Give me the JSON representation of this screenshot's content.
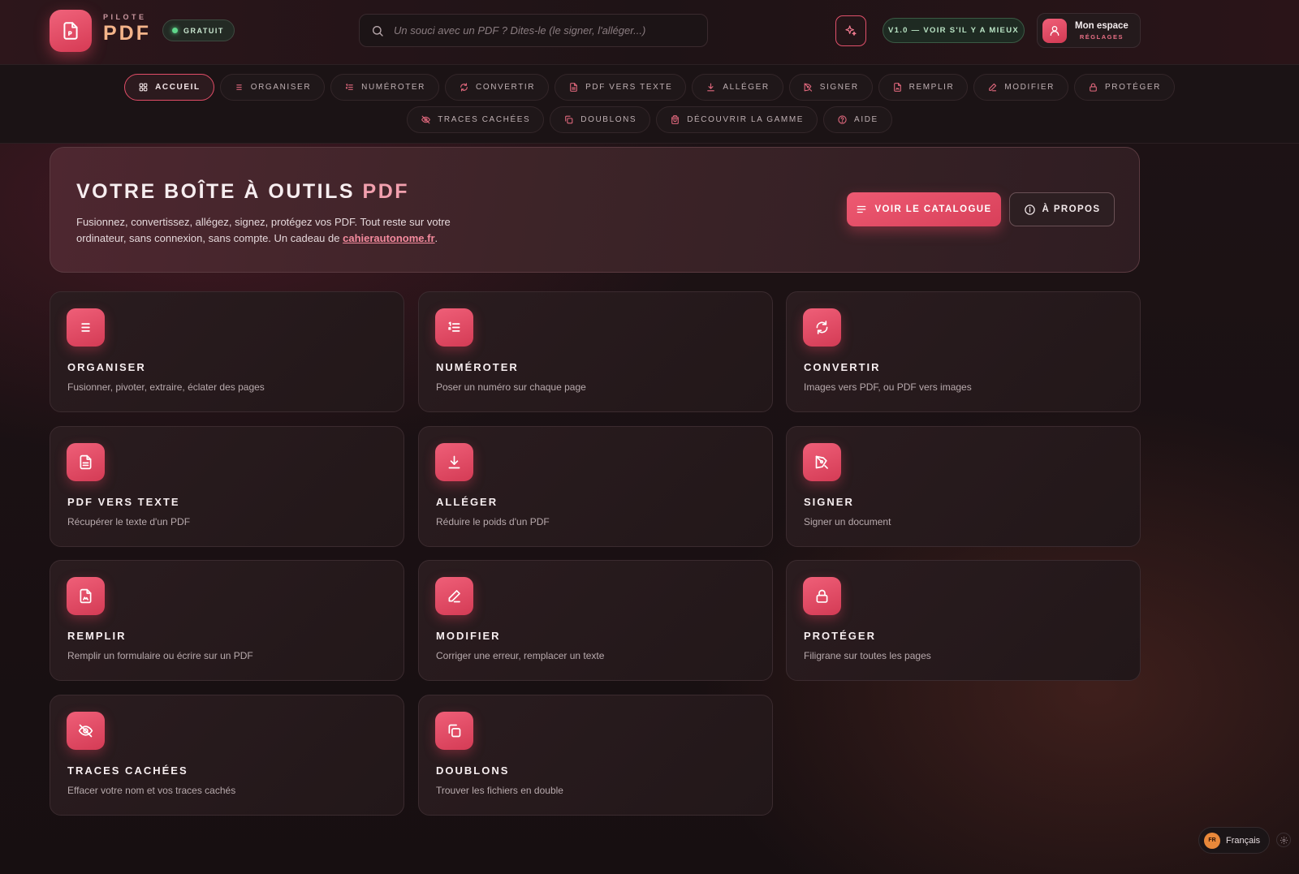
{
  "header": {
    "brand_small": "PILOTE",
    "brand_big": "PDF",
    "free_badge": "GRATUIT",
    "search_placeholder": "Un souci avec un PDF ? Dites-le (le signer, l'alléger...)",
    "version": "V1.0 — VOIR S'IL Y A MIEUX",
    "account_name": "Mon espace",
    "account_sub": "RÉGLAGES"
  },
  "nav": {
    "row1": [
      {
        "label": "ACCUEIL",
        "icon": "grid-icon",
        "active": true
      },
      {
        "label": "ORGANISER",
        "icon": "list-icon"
      },
      {
        "label": "NUMÉROTER",
        "icon": "numbered-list-icon"
      },
      {
        "label": "CONVERTIR",
        "icon": "refresh-icon"
      },
      {
        "label": "PDF VERS TEXTE",
        "icon": "file-text-icon"
      },
      {
        "label": "ALLÉGER",
        "icon": "download-icon"
      },
      {
        "label": "SIGNER",
        "icon": "pen-tool-icon"
      },
      {
        "label": "REMPLIR",
        "icon": "file-form-icon"
      },
      {
        "label": "MODIFIER",
        "icon": "pencil-icon"
      },
      {
        "label": "PROTÉGER",
        "icon": "lock-icon"
      }
    ],
    "row2": [
      {
        "label": "TRACES CACHÉES",
        "icon": "eye-off-icon"
      },
      {
        "label": "DOUBLONS",
        "icon": "copy-icon"
      },
      {
        "label": "DÉCOUVRIR LA GAMME",
        "icon": "bag-icon"
      },
      {
        "label": "AIDE",
        "icon": "help-icon"
      }
    ]
  },
  "hero": {
    "title_main": "VOTRE BOÎTE À OUTILS",
    "title_accent": "PDF",
    "desc_before": "Fusionnez, convertissez, allégez, signez, protégez vos PDF. Tout reste sur votre ordinateur, sans connexion, sans compte. Un cadeau de ",
    "desc_link": "cahierautonome.fr",
    "desc_after": ".",
    "primary_button": "VOIR LE CATALOGUE",
    "secondary_button": "À PROPOS"
  },
  "cards": [
    {
      "title": "ORGANISER",
      "desc": "Fusionner, pivoter, extraire, éclater des pages",
      "icon": "list-icon"
    },
    {
      "title": "NUMÉROTER",
      "desc": "Poser un numéro sur chaque page",
      "icon": "numbered-list-icon"
    },
    {
      "title": "CONVERTIR",
      "desc": "Images vers PDF, ou PDF vers images",
      "icon": "refresh-icon"
    },
    {
      "title": "PDF VERS TEXTE",
      "desc": "Récupérer le texte d'un PDF",
      "icon": "file-text-icon"
    },
    {
      "title": "ALLÉGER",
      "desc": "Réduire le poids d'un PDF",
      "icon": "download-icon"
    },
    {
      "title": "SIGNER",
      "desc": "Signer un document",
      "icon": "pen-tool-icon"
    },
    {
      "title": "REMPLIR",
      "desc": "Remplir un formulaire ou écrire sur un PDF",
      "icon": "file-form-icon"
    },
    {
      "title": "MODIFIER",
      "desc": "Corriger une erreur, remplacer un texte",
      "icon": "pencil-icon"
    },
    {
      "title": "PROTÉGER",
      "desc": "Filigrane sur toutes les pages",
      "icon": "lock-icon"
    },
    {
      "title": "TRACES CACHÉES",
      "desc": "Effacer votre nom et vos traces cachés",
      "icon": "eye-off-icon"
    },
    {
      "title": "DOUBLONS",
      "desc": "Trouver les fichiers en double",
      "icon": "copy-icon"
    }
  ],
  "language": {
    "flag": "FR",
    "label": "Français"
  },
  "colors": {
    "accent": "#e14d67",
    "background": "#1b1315",
    "success": "#5fd68b"
  }
}
